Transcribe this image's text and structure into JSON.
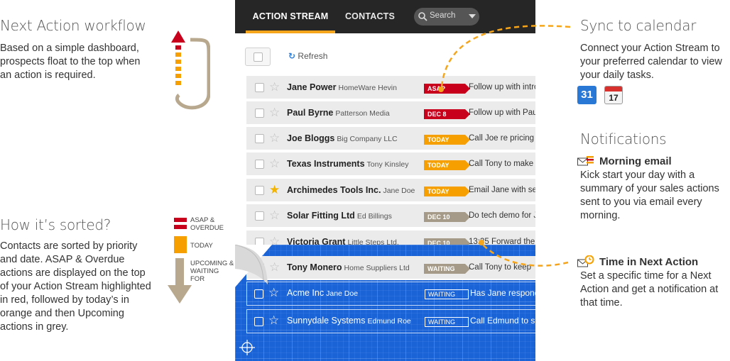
{
  "left": {
    "next_action_title": "Next Action workflow",
    "next_action_desc": "Based on a simple dashboard, prospects float to the top when an action is required.",
    "sorted_title": "How it’s sorted?",
    "sorted_desc": "Contacts are sorted by priority and date. ASAP & Overdue actions are displayed on the top of your Action Stream highlighted in red, followed by today’s in orange and then Upcoming actions in grey.",
    "legend": {
      "asap": "ASAP & OVERDUE",
      "today": "TODAY",
      "upcoming": "UPCOMING & WAITING FOR"
    }
  },
  "app": {
    "tabs": [
      "ACTION STREAM",
      "CONTACTS"
    ],
    "search_label": "Search",
    "refresh_label": "Refresh",
    "rows": [
      {
        "name": "Jane Power",
        "company": "HomeWare Hevin",
        "badge": "ASAP",
        "action": "Follow up with intro",
        "starred": false
      },
      {
        "name": "Paul Byrne",
        "company": "Patterson Media",
        "badge": "DEC 8",
        "action": "Follow up with Paul",
        "starred": false
      },
      {
        "name": "Joe Bloggs",
        "company": "Big Company LLC",
        "badge": "TODAY",
        "action": "Call Joe re pricing",
        "starred": false
      },
      {
        "name": "Texas Instruments",
        "company": "Tony Kinsley",
        "badge": "TODAY",
        "action": "Call Tony to make",
        "starred": false
      },
      {
        "name": "Archimedes Tools Inc.",
        "company": "Jane Doe",
        "badge": "TODAY",
        "action": "Email Jane with se",
        "starred": true
      },
      {
        "name": "Solar Fitting Ltd",
        "company": "Ed Billings",
        "badge": "DEC 10",
        "action": "Do tech demo for J",
        "starred": false
      },
      {
        "name": "Victoria Grant",
        "company": "Little Steps Ltd.",
        "badge": "DEC 10",
        "action": "13:35 Forward the",
        "starred": false
      },
      {
        "name": "Tony Monero",
        "company": "Home Suppliers Ltd",
        "badge": "WAITING",
        "action": "Call Tony to keep",
        "starred": false
      }
    ],
    "blueprint_rows": [
      {
        "name": "Acme Inc",
        "company": "Jane Doe",
        "badge": "WAITING",
        "action": "Has Jane respond"
      },
      {
        "name": "Sunnydale Systems",
        "company": "Edmund Roe",
        "badge": "WAITING",
        "action": "Call Edmund to s"
      }
    ],
    "colors": {
      "asap": "#c8001c",
      "today": "#f5a000",
      "upcoming": "#a59a87",
      "accent": "#f5a51c",
      "blueprint": "#1a63d6"
    }
  },
  "right": {
    "sync_title": "Sync to calendar",
    "sync_desc": "Connect your Action Stream to your preferred calendar to view your daily tasks.",
    "calendar_icons": [
      "google-calendar-icon",
      "ical-icon"
    ],
    "google_cal_day": "31",
    "ical_day": "17",
    "notifications_title": "Notifications",
    "morning_title": "Morning email",
    "morning_desc": "Kick start your day with a summary of your sales actions sent to you via email every morning.",
    "time_title": "Time in Next Action",
    "time_desc": "Set a specific time for a Next Action and get a notification at that time."
  }
}
